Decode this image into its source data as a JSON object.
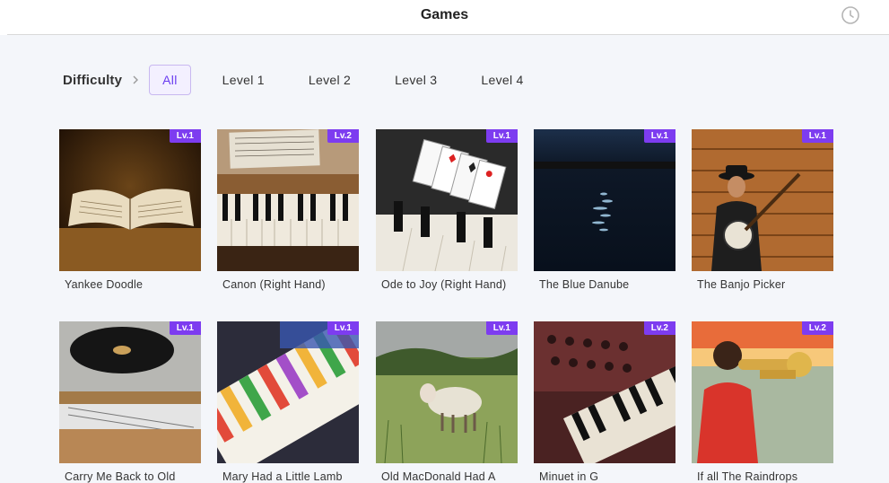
{
  "header": {
    "title": "Games",
    "history_icon": "clock-icon"
  },
  "filters": {
    "label": "Difficulty",
    "options": [
      {
        "label": "All",
        "active": true
      },
      {
        "label": "Level 1",
        "active": false
      },
      {
        "label": "Level 2",
        "active": false
      },
      {
        "label": "Level 3",
        "active": false
      },
      {
        "label": "Level 4",
        "active": false
      }
    ]
  },
  "games": [
    {
      "title": "Yankee Doodle",
      "level": "Lv.1",
      "image": "open-book"
    },
    {
      "title": "Canon (Right Hand)",
      "level": "Lv.2",
      "image": "piano-sheet-music"
    },
    {
      "title": "Ode to Joy (Right Hand)",
      "level": "Lv.1",
      "image": "playing-cards-on-keys"
    },
    {
      "title": "The Blue Danube",
      "level": "Lv.1",
      "image": "night-water"
    },
    {
      "title": "The Banjo Picker",
      "level": "Lv.1",
      "image": "banjo-player"
    },
    {
      "title": "Carry Me Back to Old",
      "level": "Lv.1",
      "image": "record-player"
    },
    {
      "title": "Mary Had a Little Lamb",
      "level": "Lv.1",
      "image": "colorful-piano"
    },
    {
      "title": "Old MacDonald Had A",
      "level": "Lv.1",
      "image": "sheep-field"
    },
    {
      "title": "Minuet in G",
      "level": "Lv.2",
      "image": "synthesizer"
    },
    {
      "title": "If all The Raindrops",
      "level": "Lv.2",
      "image": "boy-trumpet"
    }
  ],
  "colors": {
    "accent": "#7d3cf0",
    "active_chip_bg": "#f3f0ff",
    "page_bg": "#f4f6fa"
  }
}
